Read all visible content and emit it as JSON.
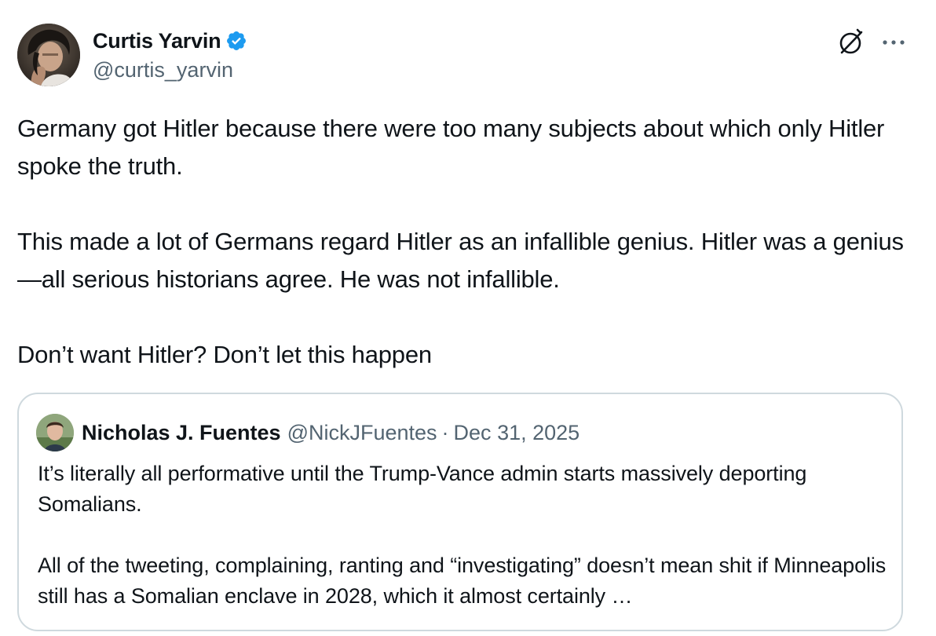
{
  "author": {
    "display_name": "Curtis Yarvin",
    "handle": "@curtis_yarvin",
    "verified": true
  },
  "icons": {
    "verified": "verified-badge-icon",
    "grok": "grok-icon",
    "more": "more-options-icon"
  },
  "colors": {
    "verified_blue": "#1d9bf0",
    "text_primary": "#0f1419",
    "text_secondary": "#536471",
    "quote_border": "#cfd9de"
  },
  "tweet": {
    "paragraphs": [
      "Germany got Hitler because there were too many subjects about which only Hitler spoke the truth.",
      "This made a lot of Germans regard Hitler as an infallible genius. Hitler was a genius—all serious historians agree. He was not infallible.",
      "Don’t want Hitler? Don’t let this happen"
    ]
  },
  "quote": {
    "display_name": "Nicholas J. Fuentes",
    "handle": "@NickJFuentes",
    "separator": "·",
    "date": "Dec 31, 2025",
    "paragraphs": [
      "It’s literally all performative until the Trump-Vance admin starts massively deporting Somalians.",
      "All of the tweeting, complaining, ranting and “investigating” doesn’t mean shit if Minneapolis still has a Somalian enclave in 2028, which it almost certainly …"
    ]
  }
}
